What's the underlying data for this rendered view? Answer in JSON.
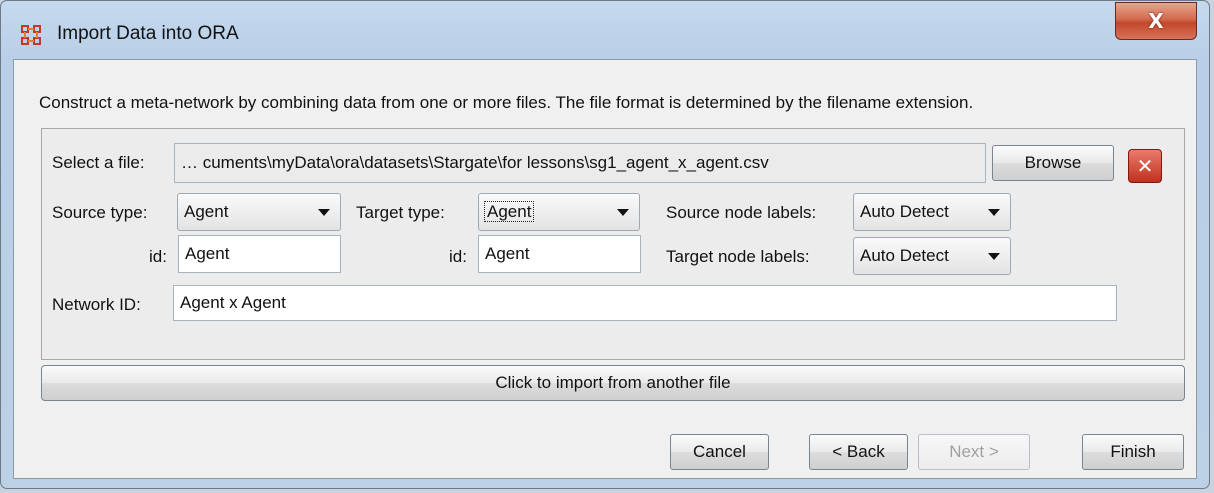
{
  "window": {
    "title": "Import Data into ORA",
    "close_symbol": "X",
    "icon": "ora-app-icon"
  },
  "instructions": "Construct a meta-network by combining data from one or more files. The file format is determined by the filename extension.",
  "file_panel": {
    "select_label": "Select a file:",
    "file_path": "… cuments\\myData\\ora\\datasets\\Stargate\\for lessons\\sg1_agent_x_agent.csv",
    "browse_label": "Browse",
    "remove_icon": "close-icon",
    "source_type_label": "Source type:",
    "source_type_value": "Agent",
    "target_type_label": "Target type:",
    "target_type_value": "Agent",
    "source_id_label": "id:",
    "source_id_value": "Agent",
    "target_id_label": "id:",
    "target_id_value": "Agent",
    "source_node_labels_label": "Source node labels:",
    "source_node_labels_value": "Auto Detect",
    "target_node_labels_label": "Target node labels:",
    "target_node_labels_value": "Auto Detect",
    "network_id_label": "Network ID:",
    "network_id_value": "Agent x Agent"
  },
  "import_another_label": "Click to import from another file",
  "footer": {
    "cancel_label": "Cancel",
    "back_label": "< Back",
    "next_label": "Next >",
    "finish_label": "Finish"
  },
  "colors": {
    "close_button": "#c2472a",
    "remove_button": "#c1301f",
    "window_frame": "#b8cfe7"
  }
}
